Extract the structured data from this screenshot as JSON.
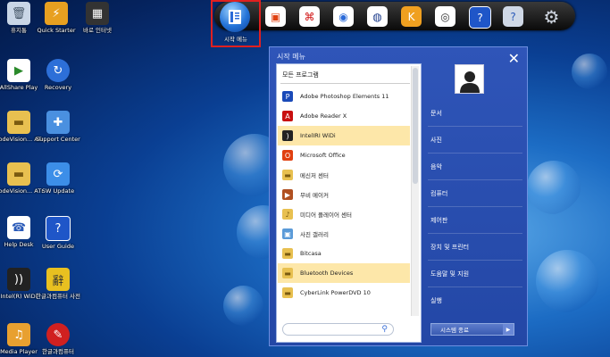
{
  "desktop": {
    "icons": [
      {
        "label": "휴지통",
        "icon": "recycle-bin-icon"
      },
      {
        "label": "Quick Starter",
        "icon": "quick-starter-icon"
      },
      {
        "label": "바로 인터넷",
        "icon": "media-icon"
      },
      {
        "label": "AllShare Play",
        "icon": "allshare-icon"
      },
      {
        "label": "Recovery",
        "icon": "recovery-icon"
      },
      {
        "label": "CodeVision... ATmega 8k...",
        "icon": "folder-icon"
      },
      {
        "label": "Support Center",
        "icon": "support-icon"
      },
      {
        "label": "CodeVision... ATmega 8...",
        "icon": "folder-icon"
      },
      {
        "label": "SW Update",
        "icon": "sw-update-icon"
      },
      {
        "label": "Help Desk",
        "icon": "help-desk-icon"
      },
      {
        "label": "User Guide",
        "icon": "user-guide-icon"
      },
      {
        "label": "Intel(R) WiDi",
        "icon": "widi-icon"
      },
      {
        "label": "한글과컴퓨터 사전",
        "icon": "hancom-dict-icon"
      },
      {
        "label": "Media Player",
        "icon": "media-player-icon"
      },
      {
        "label": "한글과컴퓨터",
        "icon": "hancom-icon"
      }
    ]
  },
  "dock": {
    "start_label": "시작 메뉴",
    "buttons": [
      "office-icon",
      "pdf-icon",
      "settings-icon",
      "globe-icon",
      "kit-icon",
      "eye-icon",
      "guide-icon",
      "help-bell-icon",
      "gear-icon"
    ]
  },
  "start_menu": {
    "title": "시작 메뉴",
    "all_programs": "모든 프로그램",
    "programs": [
      {
        "label": "Adobe Photoshop Elements 11",
        "icon": "photoshop-icon",
        "selected": false
      },
      {
        "label": "Adobe Reader X",
        "icon": "adobe-reader-icon",
        "selected": false
      },
      {
        "label": "IntelIRI WiDi",
        "icon": "widi-icon",
        "selected": true
      },
      {
        "label": "Microsoft Office",
        "icon": "office-icon",
        "selected": false
      },
      {
        "label": "메신저 센터",
        "icon": "folder-icon",
        "selected": false
      },
      {
        "label": "무비 메이커",
        "icon": "movie-maker-icon",
        "selected": false
      },
      {
        "label": "미디어 플레이어 센터",
        "icon": "media-center-icon",
        "selected": false
      },
      {
        "label": "사진 갤러리",
        "icon": "photo-gallery-icon",
        "selected": false
      },
      {
        "label": "Bitcasa",
        "icon": "folder-icon",
        "selected": false
      },
      {
        "label": "Bluetooth Devices",
        "icon": "folder-icon",
        "selected": true
      },
      {
        "label": "CyberLink PowerDVD 10",
        "icon": "folder-icon",
        "selected": false
      }
    ],
    "right_links": [
      "문서",
      "사진",
      "음악",
      "컴퓨터",
      "제어판",
      "장치 및 프린터",
      "도움말 및 지원",
      "실행"
    ],
    "shutdown_label": "시스템 종료"
  },
  "colors": {
    "highlight": "#fde7a9",
    "menu_blue": "#2a4fb0",
    "start_border": "#e02020"
  }
}
